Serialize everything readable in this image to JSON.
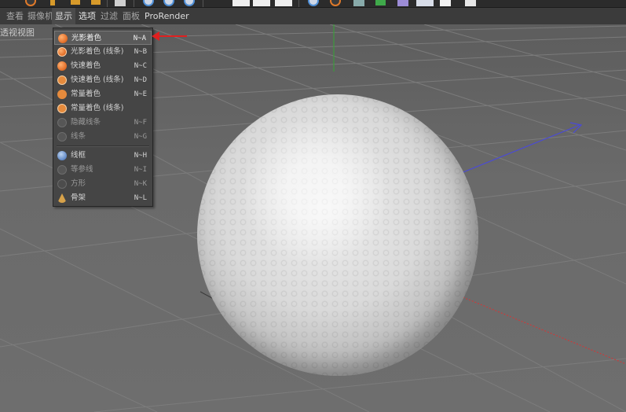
{
  "menubar": {
    "items": [
      {
        "label": "查看"
      },
      {
        "label": "摄像机"
      },
      {
        "label": "显示"
      },
      {
        "label": "选项"
      },
      {
        "label": "过滤"
      },
      {
        "label": "面板"
      },
      {
        "label": "ProRender"
      }
    ],
    "active_index": 2
  },
  "viewport": {
    "label": "透视视图"
  },
  "display_menu": {
    "items": [
      {
        "icon": "gouraud-shading-icon",
        "label": "光影着色",
        "shortcut": "N~A",
        "selected": true
      },
      {
        "icon": "gouraud-shading-lines-icon",
        "label": "光影着色 (线条)",
        "shortcut": "N~B"
      },
      {
        "icon": "quick-shading-icon",
        "label": "快速着色",
        "shortcut": "N~C"
      },
      {
        "icon": "quick-shading-lines-icon",
        "label": "快速着色 (线条)",
        "shortcut": "N~D"
      },
      {
        "icon": "constant-shading-icon",
        "label": "常量着色",
        "shortcut": "N~E"
      },
      {
        "icon": "constant-shading-lines-icon",
        "label": "常量着色 (线条)",
        "shortcut": null
      },
      {
        "icon": "hidden-line-icon",
        "label": "隐藏线条",
        "shortcut": "N~F"
      },
      {
        "icon": "lines-icon",
        "label": "线条",
        "shortcut": "N~G"
      },
      {
        "icon": "wireframe-icon",
        "label": "线框",
        "shortcut": "N~H"
      },
      {
        "icon": "isoparms-icon",
        "label": "等参线",
        "shortcut": "N~I"
      },
      {
        "icon": "box-icon",
        "label": "方形",
        "shortcut": "N~K"
      },
      {
        "icon": "skeleton-icon",
        "label": "骨架",
        "shortcut": "N~L"
      }
    ]
  },
  "colors": {
    "menu_bg": "#3b3b3b",
    "dropdown_bg": "#454545",
    "orange_icon": "#e4702a",
    "arrow": "#e02020",
    "axis_x": "#c83c3c",
    "axis_y": "#3c9a3c",
    "axis_z": "#4a4ad8"
  }
}
